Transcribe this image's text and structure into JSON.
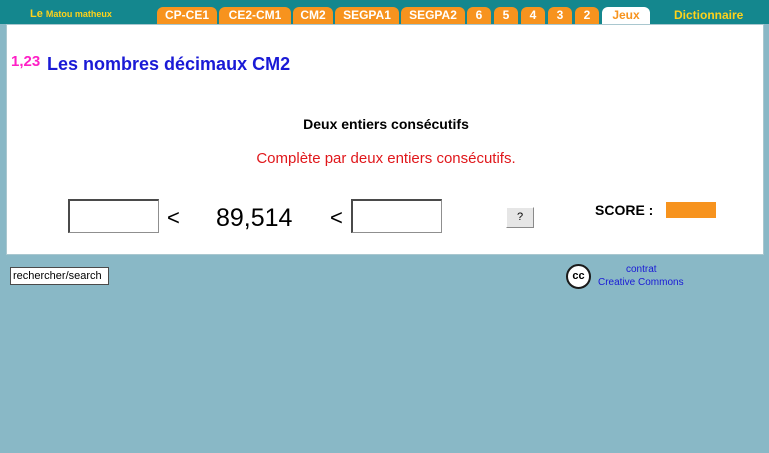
{
  "header": {
    "brand_le": "Le ",
    "brand_matou": "Matou matheux",
    "tabs": [
      {
        "label": "CP-CE1"
      },
      {
        "label": "CE2-CM1"
      },
      {
        "label": "CM2"
      },
      {
        "label": "SEGPA1"
      },
      {
        "label": "SEGPA2"
      },
      {
        "label": "6"
      },
      {
        "label": "5"
      },
      {
        "label": "4"
      },
      {
        "label": "3"
      },
      {
        "label": "2"
      },
      {
        "label": "Jeux",
        "active": true
      }
    ],
    "dictionary_label": "Dictionnaire"
  },
  "main": {
    "icon_text": "1,23",
    "title": "Les nombres décimaux CM2",
    "subtitle": "Deux entiers consécutifs",
    "instruction": "Complète par deux entiers consécutifs.",
    "lt_symbol": "<",
    "decimal_value": "89,514",
    "help_label": "?",
    "score_label": "SCORE :"
  },
  "footer": {
    "search_value": "rechercher/search",
    "cc_icon": "cc",
    "cc_line1": "contrat",
    "cc_line2": "Creative Commons"
  },
  "colors": {
    "topbar": "#14878e",
    "tab": "#f7931e",
    "brand": "#ffd21a",
    "title": "#1a1ad6",
    "instruction": "#e0171b",
    "background": "#89b8c6"
  }
}
